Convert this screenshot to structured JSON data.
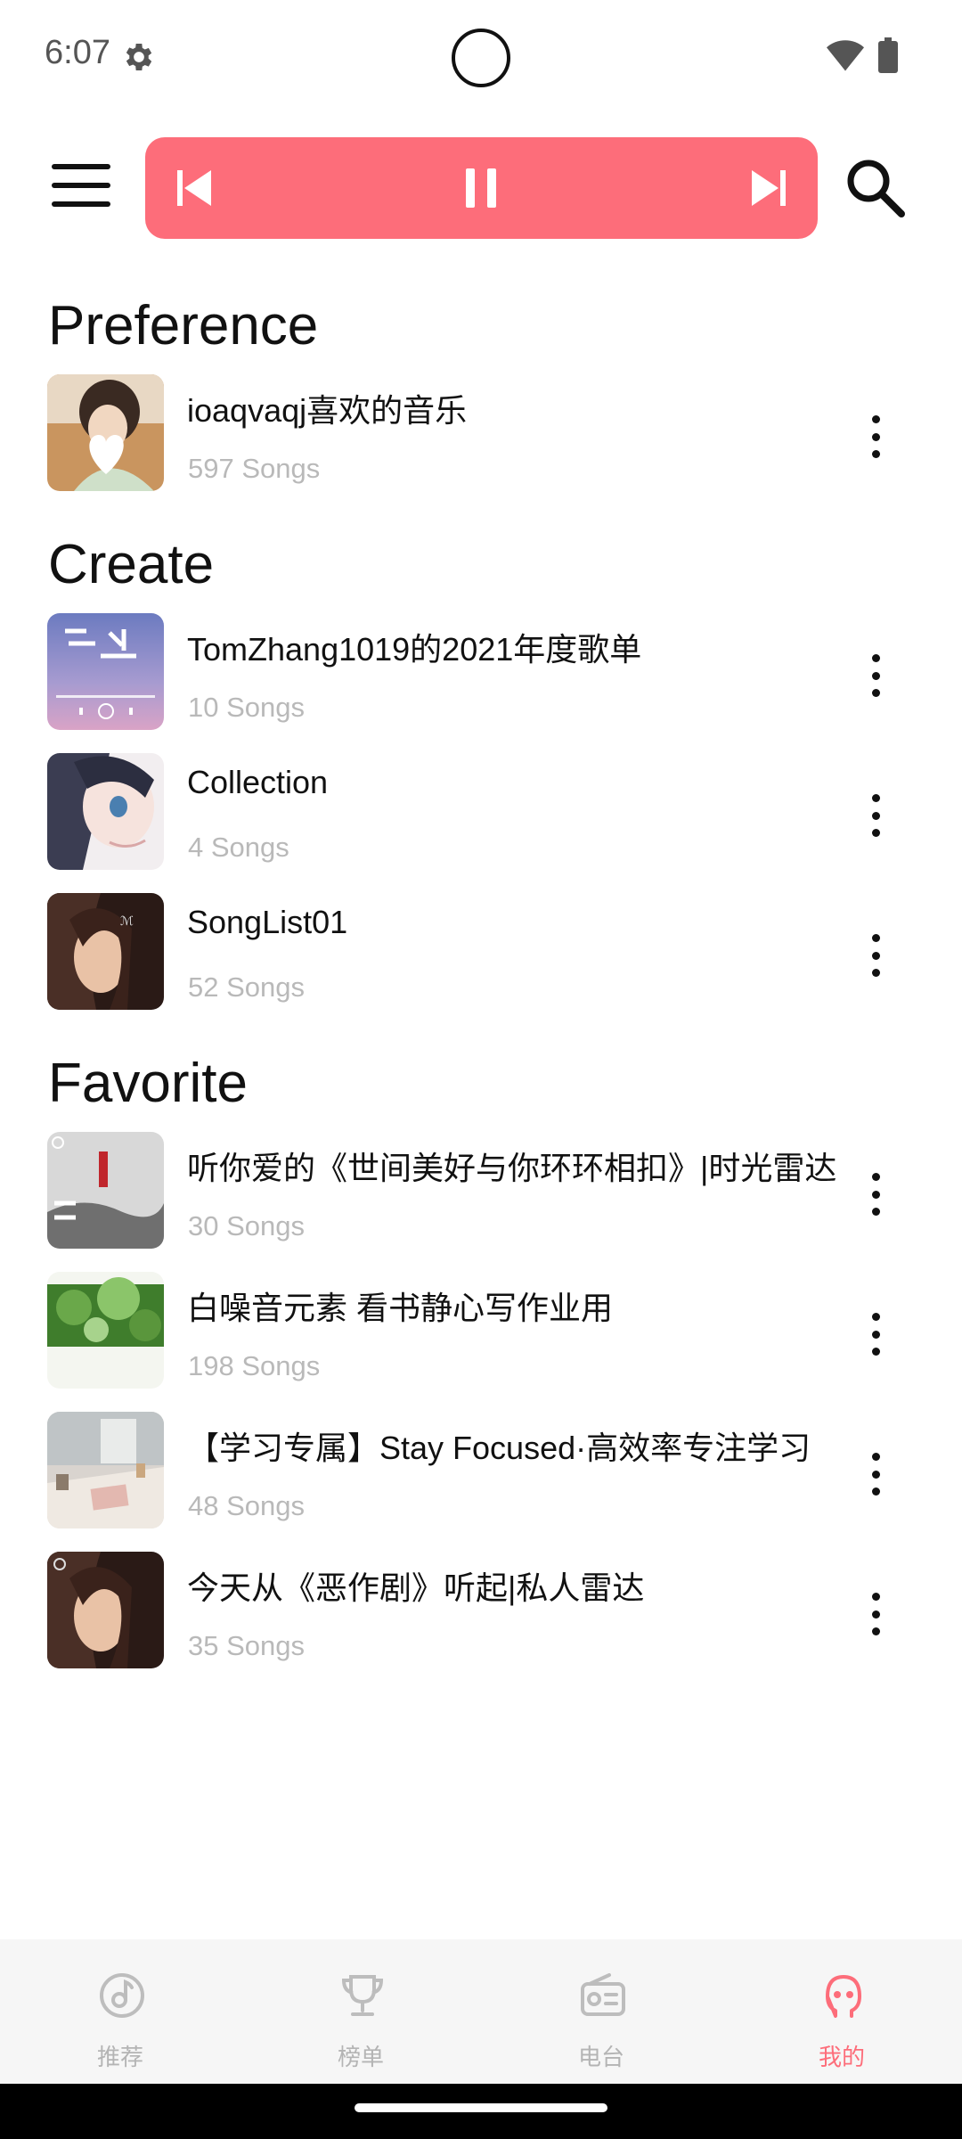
{
  "status_bar": {
    "time": "6:07"
  },
  "player": {
    "accent_color": "#fd6d7a"
  },
  "sections": {
    "preference": {
      "title": "Preference",
      "items": [
        {
          "title": "ioaqvaqj喜欢的音乐",
          "count": "597 Songs"
        }
      ]
    },
    "create": {
      "title": "Create",
      "items": [
        {
          "title": "TomZhang1019的2021年度歌单",
          "count": "10 Songs"
        },
        {
          "title": "Collection",
          "count": "4 Songs"
        },
        {
          "title": "SongList01",
          "count": "52 Songs"
        }
      ]
    },
    "favorite": {
      "title": "Favorite",
      "items": [
        {
          "title": "听你爱的《世间美好与你环环相扣》|时光雷达",
          "count": "30 Songs"
        },
        {
          "title": "白噪音元素 看书静心写作业用",
          "count": "198 Songs"
        },
        {
          "title": "【学习专属】Stay Focused·高效率专注学习",
          "count": "48 Songs"
        },
        {
          "title": "今天从《恶作剧》听起|私人雷达",
          "count": "35 Songs"
        }
      ]
    }
  },
  "bottom_nav": {
    "items": [
      {
        "label": "推荐",
        "icon": "music-note-icon"
      },
      {
        "label": "榜单",
        "icon": "trophy-icon"
      },
      {
        "label": "电台",
        "icon": "radio-icon"
      },
      {
        "label": "我的",
        "icon": "profile-icon",
        "active": true
      }
    ]
  }
}
